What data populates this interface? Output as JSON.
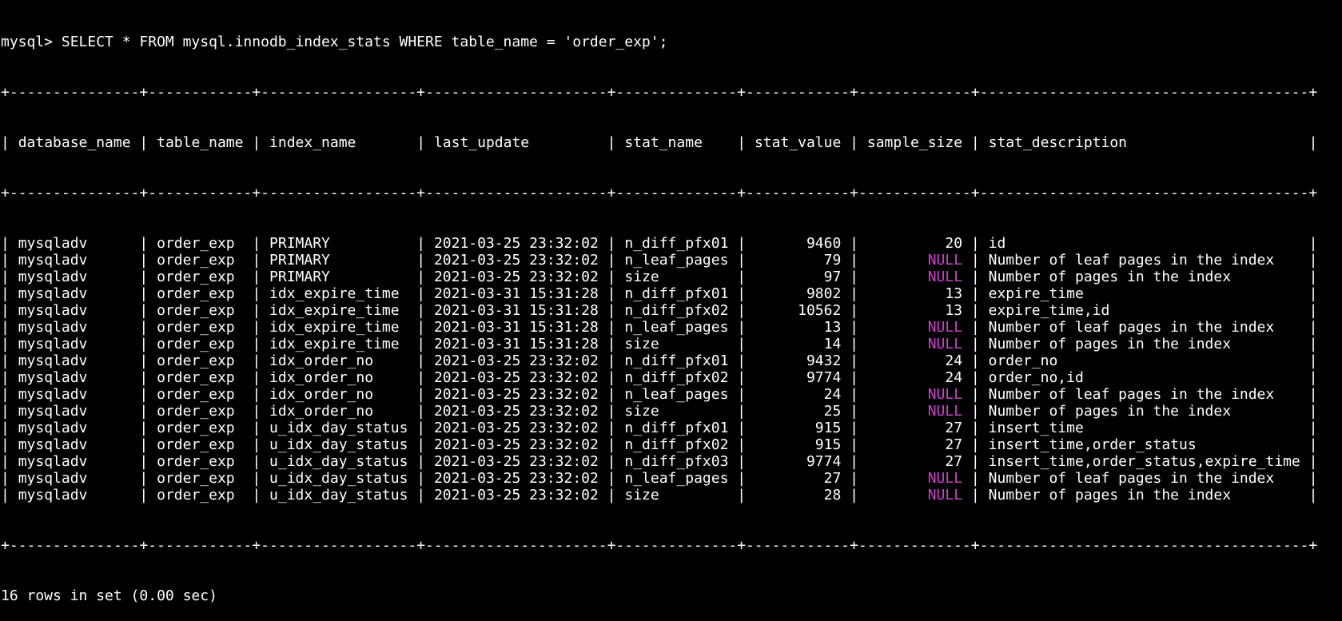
{
  "terminal": {
    "prompt": "mysql> ",
    "command": "SELECT * FROM mysql.innodb_index_stats WHERE table_name = 'order_exp';",
    "footer": "16 rows in set (0.00 sec)",
    "null_color": "#d040d0"
  },
  "table": {
    "columns": [
      "database_name",
      "table_name",
      "index_name",
      "last_update",
      "stat_name",
      "stat_value",
      "sample_size",
      "stat_description"
    ],
    "rows": [
      [
        "mysqladv",
        "order_exp",
        "PRIMARY",
        "2021-03-25 23:32:02",
        "n_diff_pfx01",
        "9460",
        "20",
        "id"
      ],
      [
        "mysqladv",
        "order_exp",
        "PRIMARY",
        "2021-03-25 23:32:02",
        "n_leaf_pages",
        "79",
        "NULL",
        "Number of leaf pages in the index"
      ],
      [
        "mysqladv",
        "order_exp",
        "PRIMARY",
        "2021-03-25 23:32:02",
        "size",
        "97",
        "NULL",
        "Number of pages in the index"
      ],
      [
        "mysqladv",
        "order_exp",
        "idx_expire_time",
        "2021-03-31 15:31:28",
        "n_diff_pfx01",
        "9802",
        "13",
        "expire_time"
      ],
      [
        "mysqladv",
        "order_exp",
        "idx_expire_time",
        "2021-03-31 15:31:28",
        "n_diff_pfx02",
        "10562",
        "13",
        "expire_time,id"
      ],
      [
        "mysqladv",
        "order_exp",
        "idx_expire_time",
        "2021-03-31 15:31:28",
        "n_leaf_pages",
        "13",
        "NULL",
        "Number of leaf pages in the index"
      ],
      [
        "mysqladv",
        "order_exp",
        "idx_expire_time",
        "2021-03-31 15:31:28",
        "size",
        "14",
        "NULL",
        "Number of pages in the index"
      ],
      [
        "mysqladv",
        "order_exp",
        "idx_order_no",
        "2021-03-25 23:32:02",
        "n_diff_pfx01",
        "9432",
        "24",
        "order_no"
      ],
      [
        "mysqladv",
        "order_exp",
        "idx_order_no",
        "2021-03-25 23:32:02",
        "n_diff_pfx02",
        "9774",
        "24",
        "order_no,id"
      ],
      [
        "mysqladv",
        "order_exp",
        "idx_order_no",
        "2021-03-25 23:32:02",
        "n_leaf_pages",
        "24",
        "NULL",
        "Number of leaf pages in the index"
      ],
      [
        "mysqladv",
        "order_exp",
        "idx_order_no",
        "2021-03-25 23:32:02",
        "size",
        "25",
        "NULL",
        "Number of pages in the index"
      ],
      [
        "mysqladv",
        "order_exp",
        "u_idx_day_status",
        "2021-03-25 23:32:02",
        "n_diff_pfx01",
        "915",
        "27",
        "insert_time"
      ],
      [
        "mysqladv",
        "order_exp",
        "u_idx_day_status",
        "2021-03-25 23:32:02",
        "n_diff_pfx02",
        "915",
        "27",
        "insert_time,order_status"
      ],
      [
        "mysqladv",
        "order_exp",
        "u_idx_day_status",
        "2021-03-25 23:32:02",
        "n_diff_pfx03",
        "9774",
        "27",
        "insert_time,order_status,expire_time"
      ],
      [
        "mysqladv",
        "order_exp",
        "u_idx_day_status",
        "2021-03-25 23:32:02",
        "n_leaf_pages",
        "27",
        "NULL",
        "Number of leaf pages in the index"
      ],
      [
        "mysqladv",
        "order_exp",
        "u_idx_day_status",
        "2021-03-25 23:32:02",
        "size",
        "28",
        "NULL",
        "Number of pages in the index"
      ]
    ]
  }
}
